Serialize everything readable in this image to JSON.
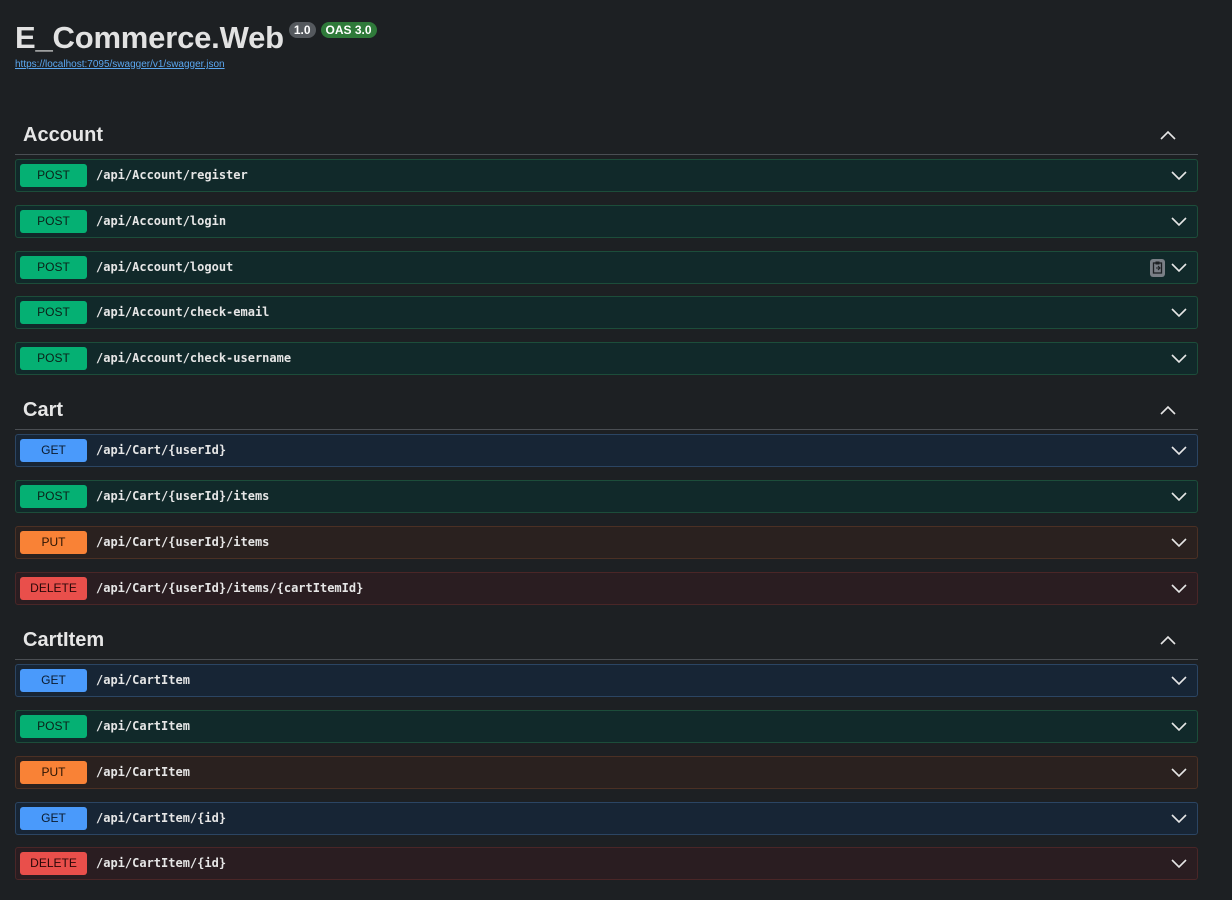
{
  "info": {
    "title": "E_Commerce.Web",
    "version_badge": "1.0",
    "oas_badge": "OAS 3.0",
    "spec_url": "https://localhost:7095/swagger/v1/swagger.json"
  },
  "sections": [
    {
      "name": "Account",
      "ops": [
        {
          "method": "POST",
          "path": "/api/Account/register"
        },
        {
          "method": "POST",
          "path": "/api/Account/login"
        },
        {
          "method": "POST",
          "path": "/api/Account/logout"
        },
        {
          "method": "POST",
          "path": "/api/Account/check-email"
        },
        {
          "method": "POST",
          "path": "/api/Account/check-username"
        }
      ]
    },
    {
      "name": "Cart",
      "ops": [
        {
          "method": "GET",
          "path": "/api/Cart/{userId}"
        },
        {
          "method": "POST",
          "path": "/api/Cart/{userId}/items"
        },
        {
          "method": "PUT",
          "path": "/api/Cart/{userId}/items"
        },
        {
          "method": "DELETE",
          "path": "/api/Cart/{userId}/items/{cartItemId}"
        }
      ]
    },
    {
      "name": "CartItem",
      "ops": [
        {
          "method": "GET",
          "path": "/api/CartItem"
        },
        {
          "method": "POST",
          "path": "/api/CartItem"
        },
        {
          "method": "PUT",
          "path": "/api/CartItem"
        },
        {
          "method": "GET",
          "path": "/api/CartItem/{id}"
        },
        {
          "method": "DELETE",
          "path": "/api/CartItem/{id}"
        }
      ]
    }
  ],
  "icons": {
    "expand": "chevron-down-icon",
    "collapse": "chevron-up-icon",
    "copy": "clipboard-icon"
  }
}
